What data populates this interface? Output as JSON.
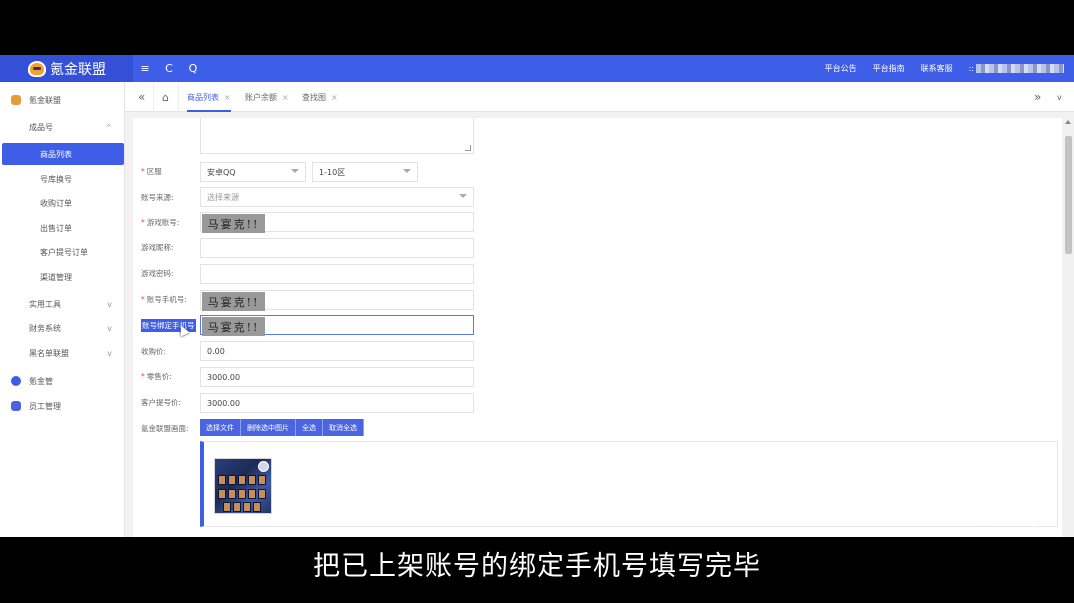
{
  "app": {
    "brand": "氪金联盟",
    "toolbar": {
      "menu_icon": "≡",
      "refresh_icon": "C",
      "search_icon": "Q"
    },
    "top_links": [
      "平台公告",
      "平台指南",
      "联系客服"
    ],
    "user_prefix": "::"
  },
  "sidebar": {
    "root": "氪金联盟",
    "group": "成品号",
    "sub_items": [
      "商品列表",
      "号库换号",
      "收购订单",
      "出售订单",
      "客户提号订单",
      "渠道管理"
    ],
    "groups": [
      "实用工具",
      "财务系统",
      "黑名单联盟"
    ],
    "bottom": [
      "氪金管",
      "员工管理"
    ],
    "arrow_up": "^",
    "arrow_down": "v"
  },
  "tabs": {
    "back_icon": "«",
    "home_icon": "⌂",
    "items": [
      "商品列表",
      "账户余额",
      "查找图"
    ],
    "close": "×",
    "forward_icon": "»",
    "more_icon": "v"
  },
  "form": {
    "region_label": "区服",
    "region_value": "安卓QQ",
    "zone_value": "1-10区",
    "source_label": "账号来源:",
    "source_placeholder": "选择来源",
    "account_label": "游戏账号:",
    "account_value": "马宴克!!",
    "nickname_label": "游戏昵称:",
    "password_label": "游戏密码:",
    "phone_label": "账号手机号:",
    "phone_value": "马宴克!!",
    "bound_phone_label": "账号绑定手机号",
    "bound_phone_value": "马宴克!!",
    "buy_price_label": "收购价:",
    "buy_price_value": "0.00",
    "retail_label": "零售价:",
    "retail_value": "3000.00",
    "client_price_label": "客户提号价:",
    "client_price_value": "3000.00",
    "image_label": "氪金联盟画面:",
    "buttons": [
      "选择文件",
      "删除选中图片",
      "全选",
      "取消全选"
    ]
  },
  "subtitle": "把已上架账号的绑定手机号填写完毕"
}
